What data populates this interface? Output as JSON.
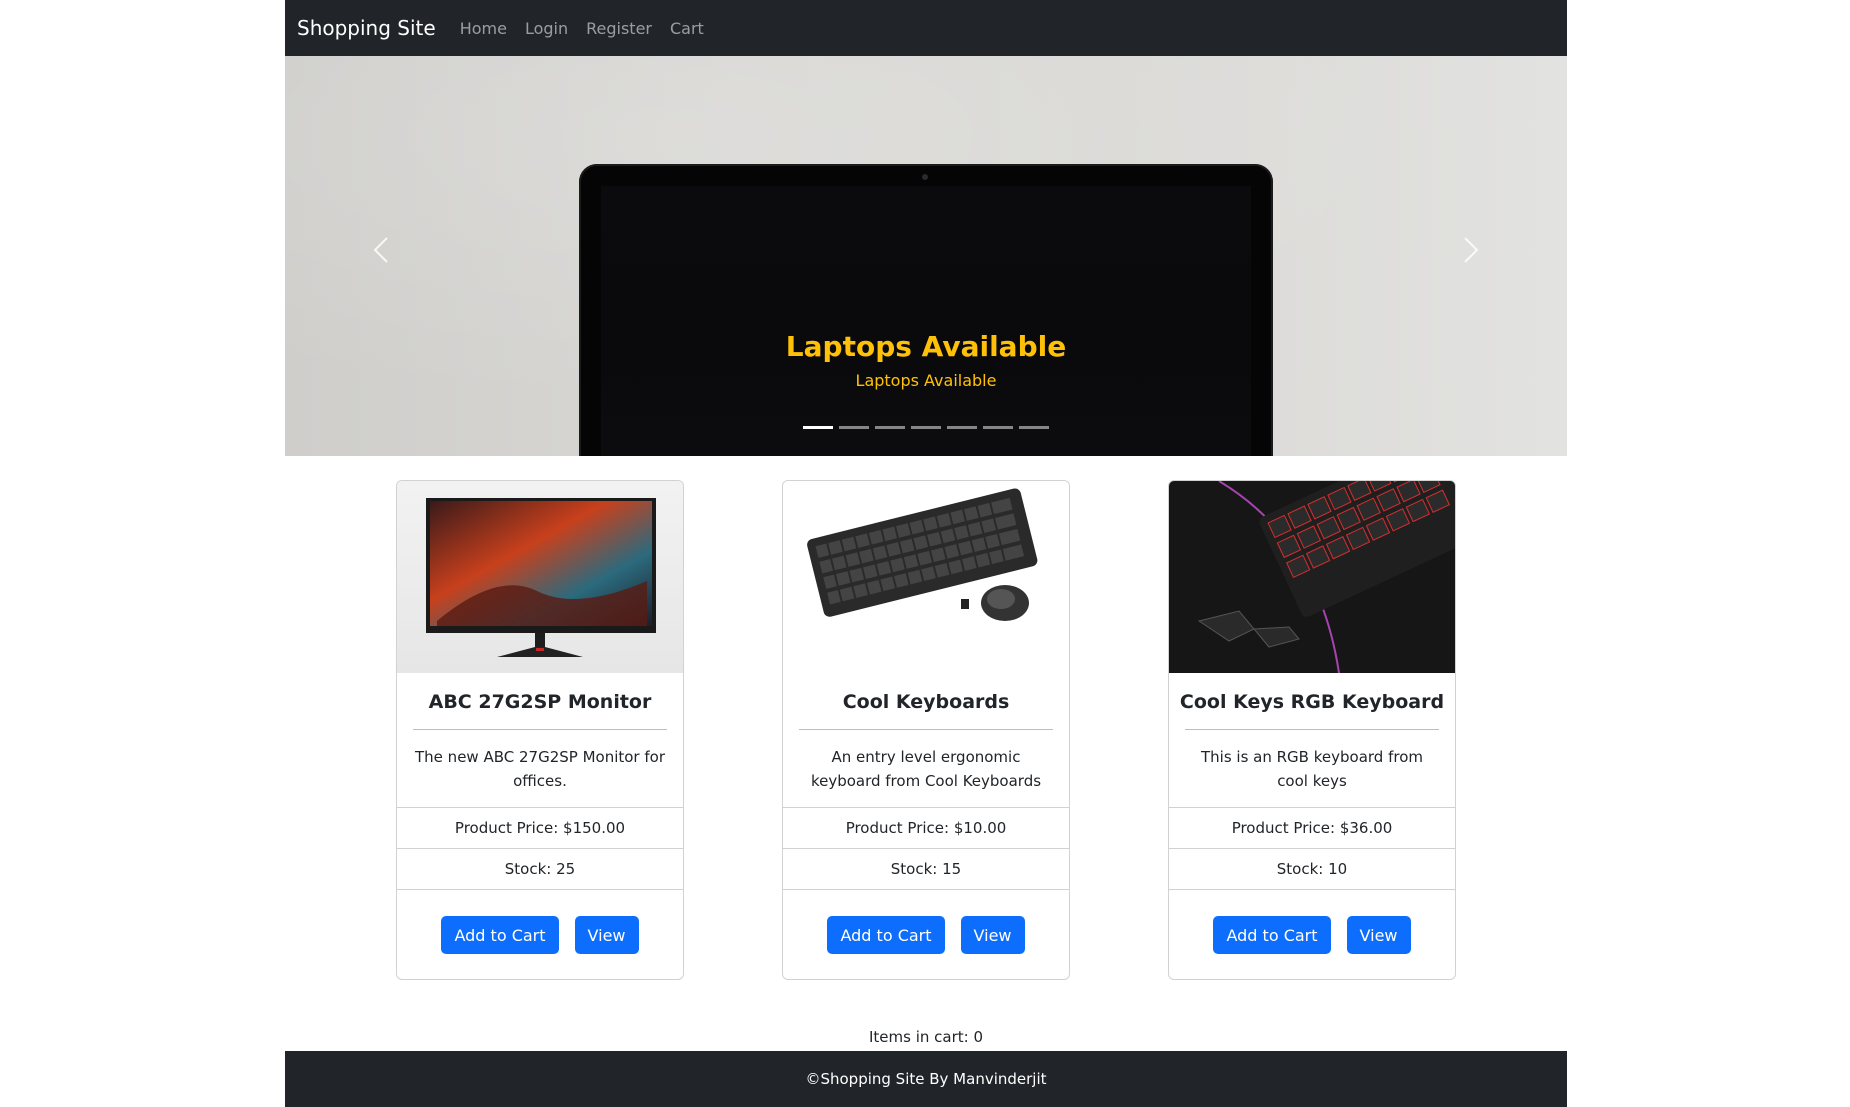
{
  "navbar": {
    "brand": "Shopping Site",
    "links": [
      "Home",
      "Login",
      "Register",
      "Cart"
    ]
  },
  "carousel": {
    "title": "Laptops Available",
    "subtitle": "Laptops Available",
    "prev_icon": "chevron-left-icon",
    "next_icon": "chevron-right-icon",
    "indicator_count": 7,
    "active_index": 0,
    "caption_color": "#ffc107"
  },
  "products": [
    {
      "name": "ABC 27G2SP Monitor",
      "description": "The new ABC 27G2SP Monitor for offices.",
      "price": "Product Price: $150.00",
      "stock": "Stock: 25",
      "add_label": "Add to Cart",
      "view_label": "View"
    },
    {
      "name": "Cool Keyboards",
      "description": "An entry level ergonomic keyboard from Cool Keyboards",
      "price": "Product Price: $10.00",
      "stock": "Stock: 15",
      "add_label": "Add to Cart",
      "view_label": "View"
    },
    {
      "name": "Cool Keys RGB Keyboard",
      "description": "This is an RGB keyboard from cool keys",
      "price": "Product Price: $36.00",
      "stock": "Stock: 10",
      "add_label": "Add to Cart",
      "view_label": "View"
    }
  ],
  "cart": {
    "count_text": "Items in cart: 0"
  },
  "footer": {
    "text": "©Shopping Site By Manvinderjit"
  },
  "colors": {
    "navbar_bg": "#212529",
    "button_primary": "#0d6efd",
    "caption": "#ffc107"
  }
}
